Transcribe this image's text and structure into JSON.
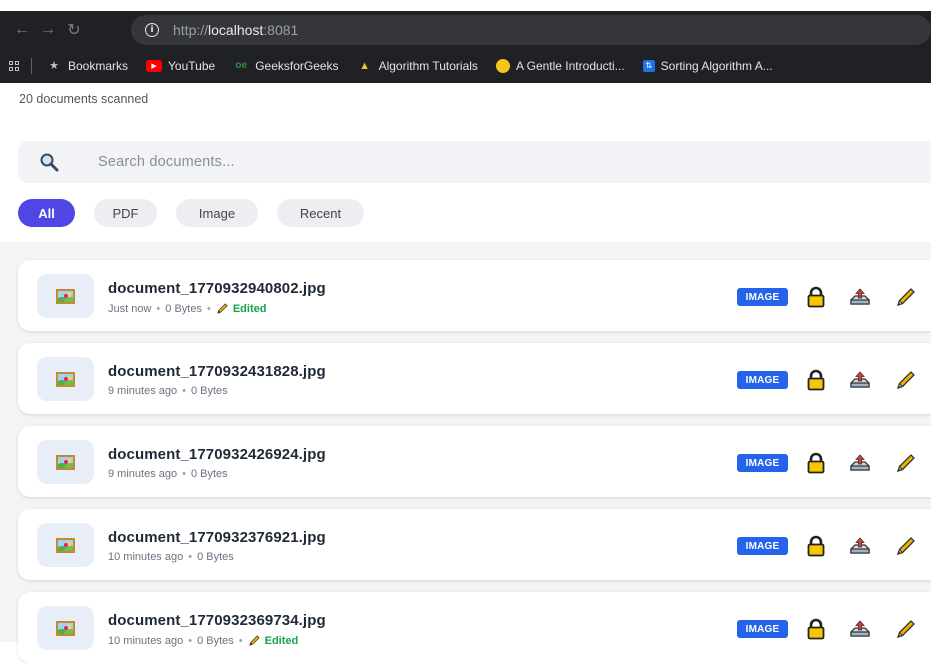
{
  "browser": {
    "url_prefix": "http://",
    "url_host": "localhost",
    "url_suffix": ":8081",
    "bookmarks": [
      {
        "label": "Bookmarks",
        "icon": "star-icon"
      },
      {
        "label": "YouTube",
        "icon": "youtube-icon"
      },
      {
        "label": "GeeksforGeeks",
        "icon": "geeksforgeeks-icon"
      },
      {
        "label": "Algorithm Tutorials",
        "icon": "algorithm-icon"
      },
      {
        "label": "A Gentle Introducti...",
        "icon": "emoji-icon"
      },
      {
        "label": "Sorting Algorithm A...",
        "icon": "sorting-icon"
      }
    ]
  },
  "page": {
    "scanned_count": "20 documents scanned",
    "search_placeholder": "Search documents...",
    "filters": [
      "All",
      "PDF",
      "Image",
      "Recent"
    ],
    "active_filter": "All"
  },
  "documents": [
    {
      "name": "document_1770932940802.jpg",
      "time": "Just now",
      "size": "0 Bytes",
      "edited": "Edited",
      "type": "IMAGE"
    },
    {
      "name": "document_1770932431828.jpg",
      "time": "9 minutes ago",
      "size": "0 Bytes",
      "edited": "",
      "type": "IMAGE"
    },
    {
      "name": "document_1770932426924.jpg",
      "time": "9 minutes ago",
      "size": "0 Bytes",
      "edited": "",
      "type": "IMAGE"
    },
    {
      "name": "document_1770932376921.jpg",
      "time": "10 minutes ago",
      "size": "0 Bytes",
      "edited": "",
      "type": "IMAGE"
    },
    {
      "name": "document_1770932369734.jpg",
      "time": "10 minutes ago",
      "size": "0 Bytes",
      "edited": "Edited",
      "type": "IMAGE"
    }
  ],
  "colors": {
    "accent": "#4f46e5",
    "badge": "#2563eb",
    "edited": "#16a34a"
  }
}
